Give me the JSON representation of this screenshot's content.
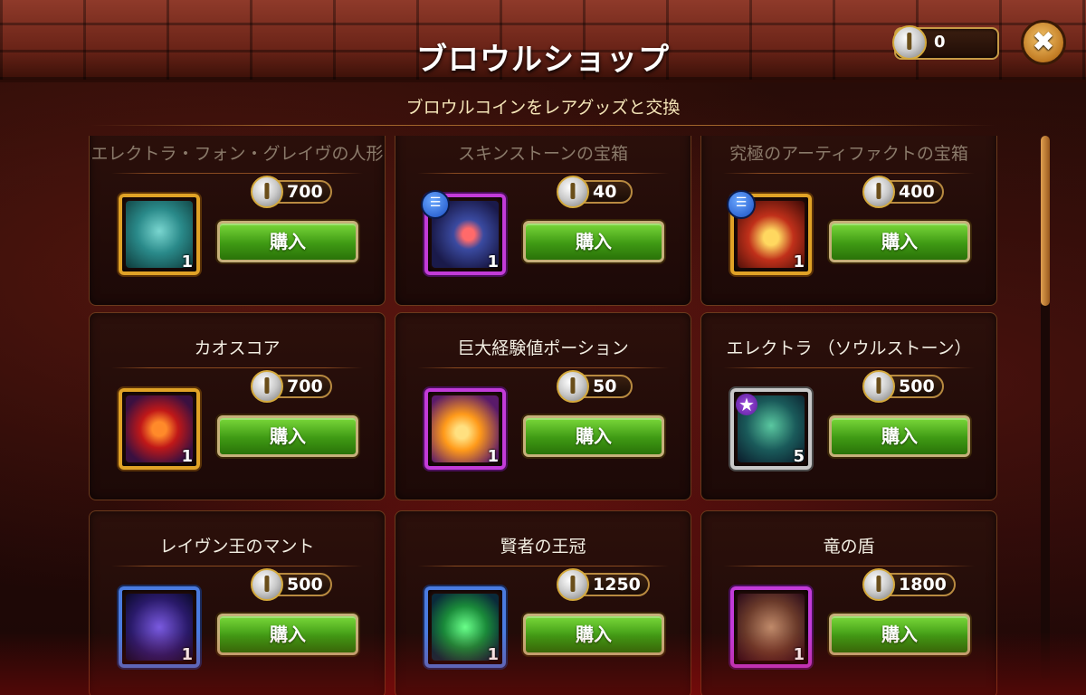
{
  "header": {
    "title": "ブロウルショップ",
    "coin_balance": "0",
    "close_label": "✖"
  },
  "subtitle": "ブロウルコインをレアグッズと交換",
  "buy_label": "購入",
  "items": [
    {
      "name": "エレクトラ・フォン・グレイヴの人形",
      "price": "700",
      "qty": "1",
      "frame": "gold",
      "art": "doll",
      "badge": false,
      "dim": true
    },
    {
      "name": "スキンストーンの宝箱",
      "price": "40",
      "qty": "1",
      "frame": "purple",
      "art": "cube",
      "badge": true,
      "dim": true
    },
    {
      "name": "究極のアーティファクトの宝箱",
      "price": "400",
      "qty": "1",
      "frame": "gold",
      "art": "chest",
      "badge": true,
      "dim": true
    },
    {
      "name": "カオスコア",
      "price": "700",
      "qty": "1",
      "frame": "gold",
      "art": "core",
      "badge": false,
      "dim": false
    },
    {
      "name": "巨大経験値ポーション",
      "price": "50",
      "qty": "1",
      "frame": "purple",
      "art": "potion",
      "badge": false,
      "dim": false
    },
    {
      "name": "エレクトラ （ソウルストーン）",
      "price": "500",
      "qty": "5",
      "frame": "silver",
      "art": "hero",
      "badge": false,
      "dim": false
    },
    {
      "name": "レイヴン王のマント",
      "price": "500",
      "qty": "1",
      "frame": "blue",
      "art": "cloak",
      "badge": false,
      "dim": false
    },
    {
      "name": "賢者の王冠",
      "price": "1250",
      "qty": "1",
      "frame": "blue",
      "art": "crown",
      "badge": false,
      "dim": false
    },
    {
      "name": "竜の盾",
      "price": "1800",
      "qty": "1",
      "frame": "purple",
      "art": "shield",
      "badge": false,
      "dim": false
    }
  ]
}
